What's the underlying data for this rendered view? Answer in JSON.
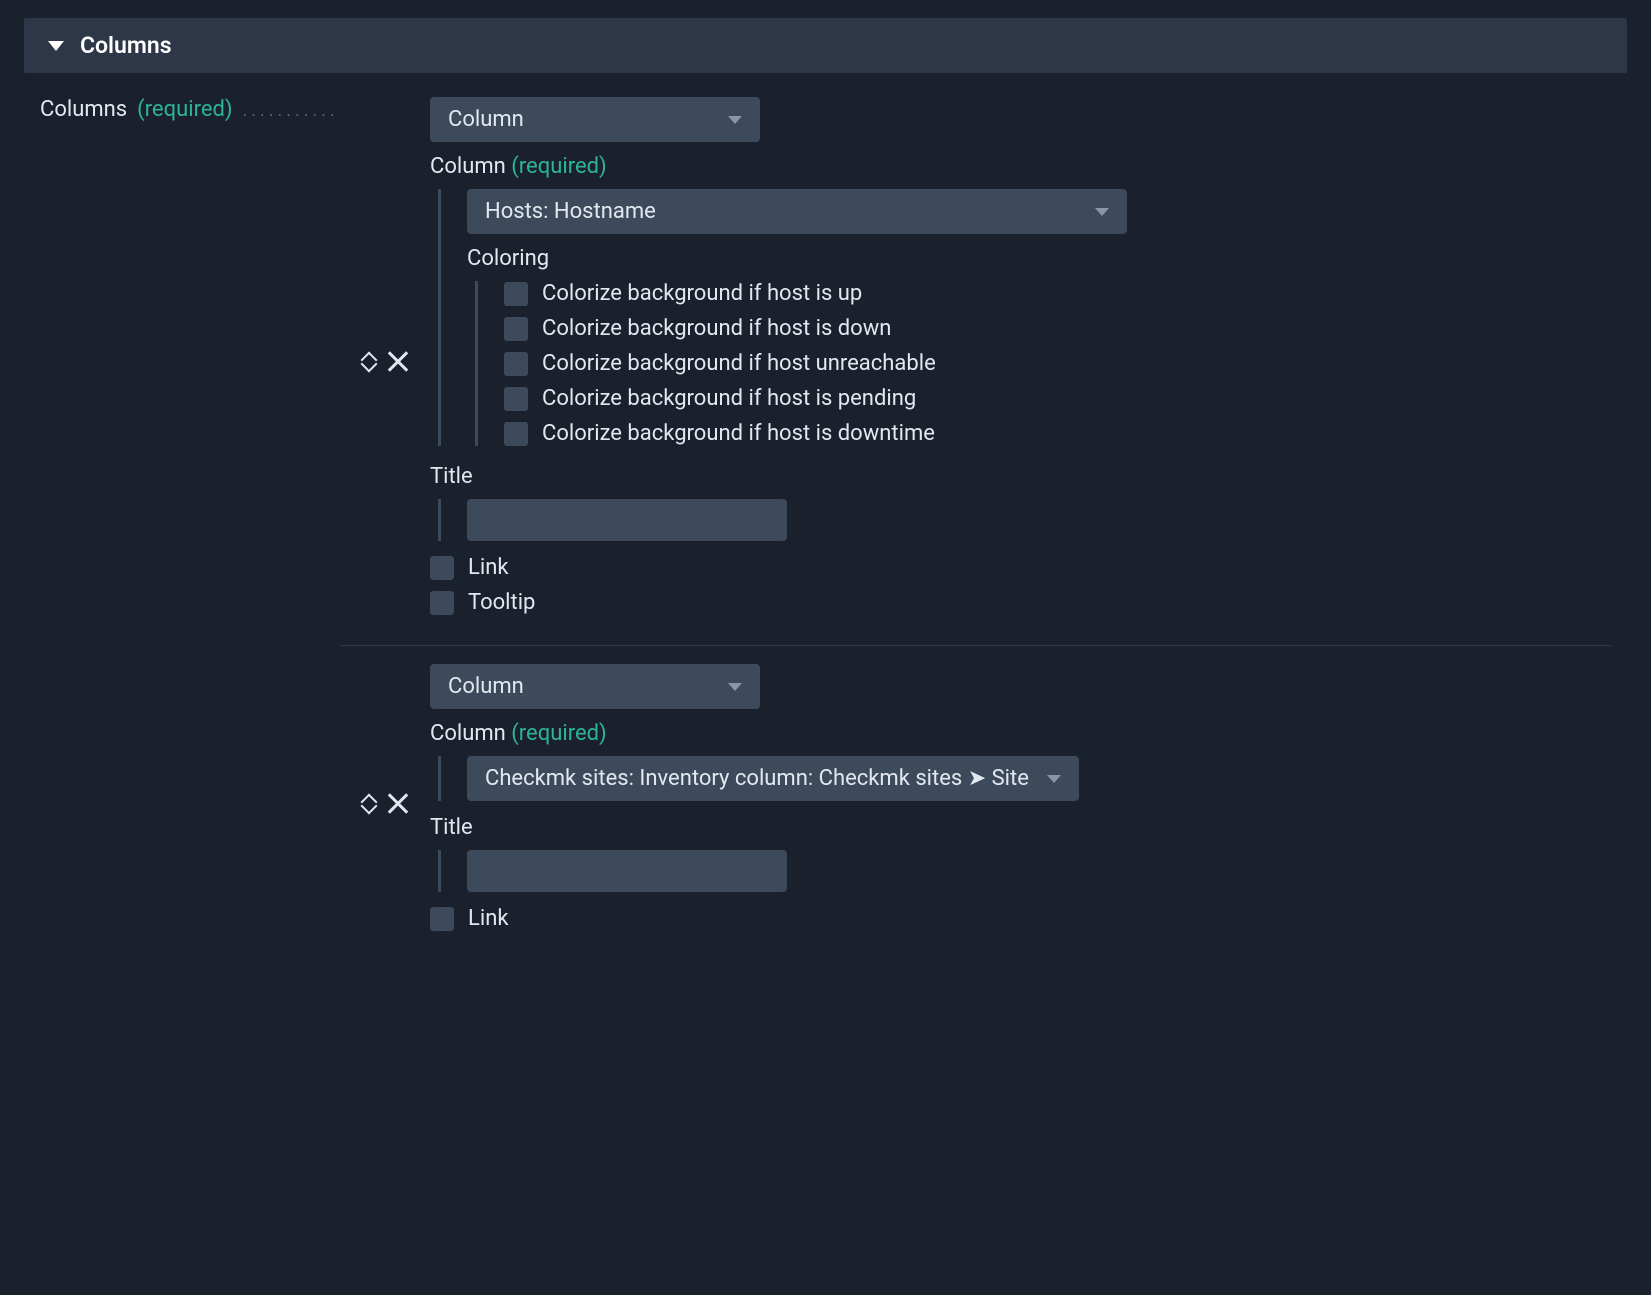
{
  "section": {
    "title": "Columns"
  },
  "field": {
    "label": "Columns",
    "required": "(required)",
    "dots": "............"
  },
  "labels": {
    "column_type": "Column",
    "column_field": "Column",
    "column_required": "(required)",
    "coloring": "Coloring",
    "title": "Title",
    "link": "Link",
    "tooltip": "Tooltip"
  },
  "entries": [
    {
      "type_value": "Column",
      "column_value": "Hosts: Hostname",
      "coloring_options": [
        "Colorize background if host is up",
        "Colorize background if host is down",
        "Colorize background if host unreachable",
        "Colorize background if host is pending",
        "Colorize background if host is downtime"
      ],
      "title_value": "",
      "show_tooltip": true
    },
    {
      "type_value": "Column",
      "column_value": "Checkmk sites: Inventory column: Checkmk sites ➤ Site",
      "coloring_options": [],
      "title_value": "",
      "show_tooltip": false
    }
  ]
}
